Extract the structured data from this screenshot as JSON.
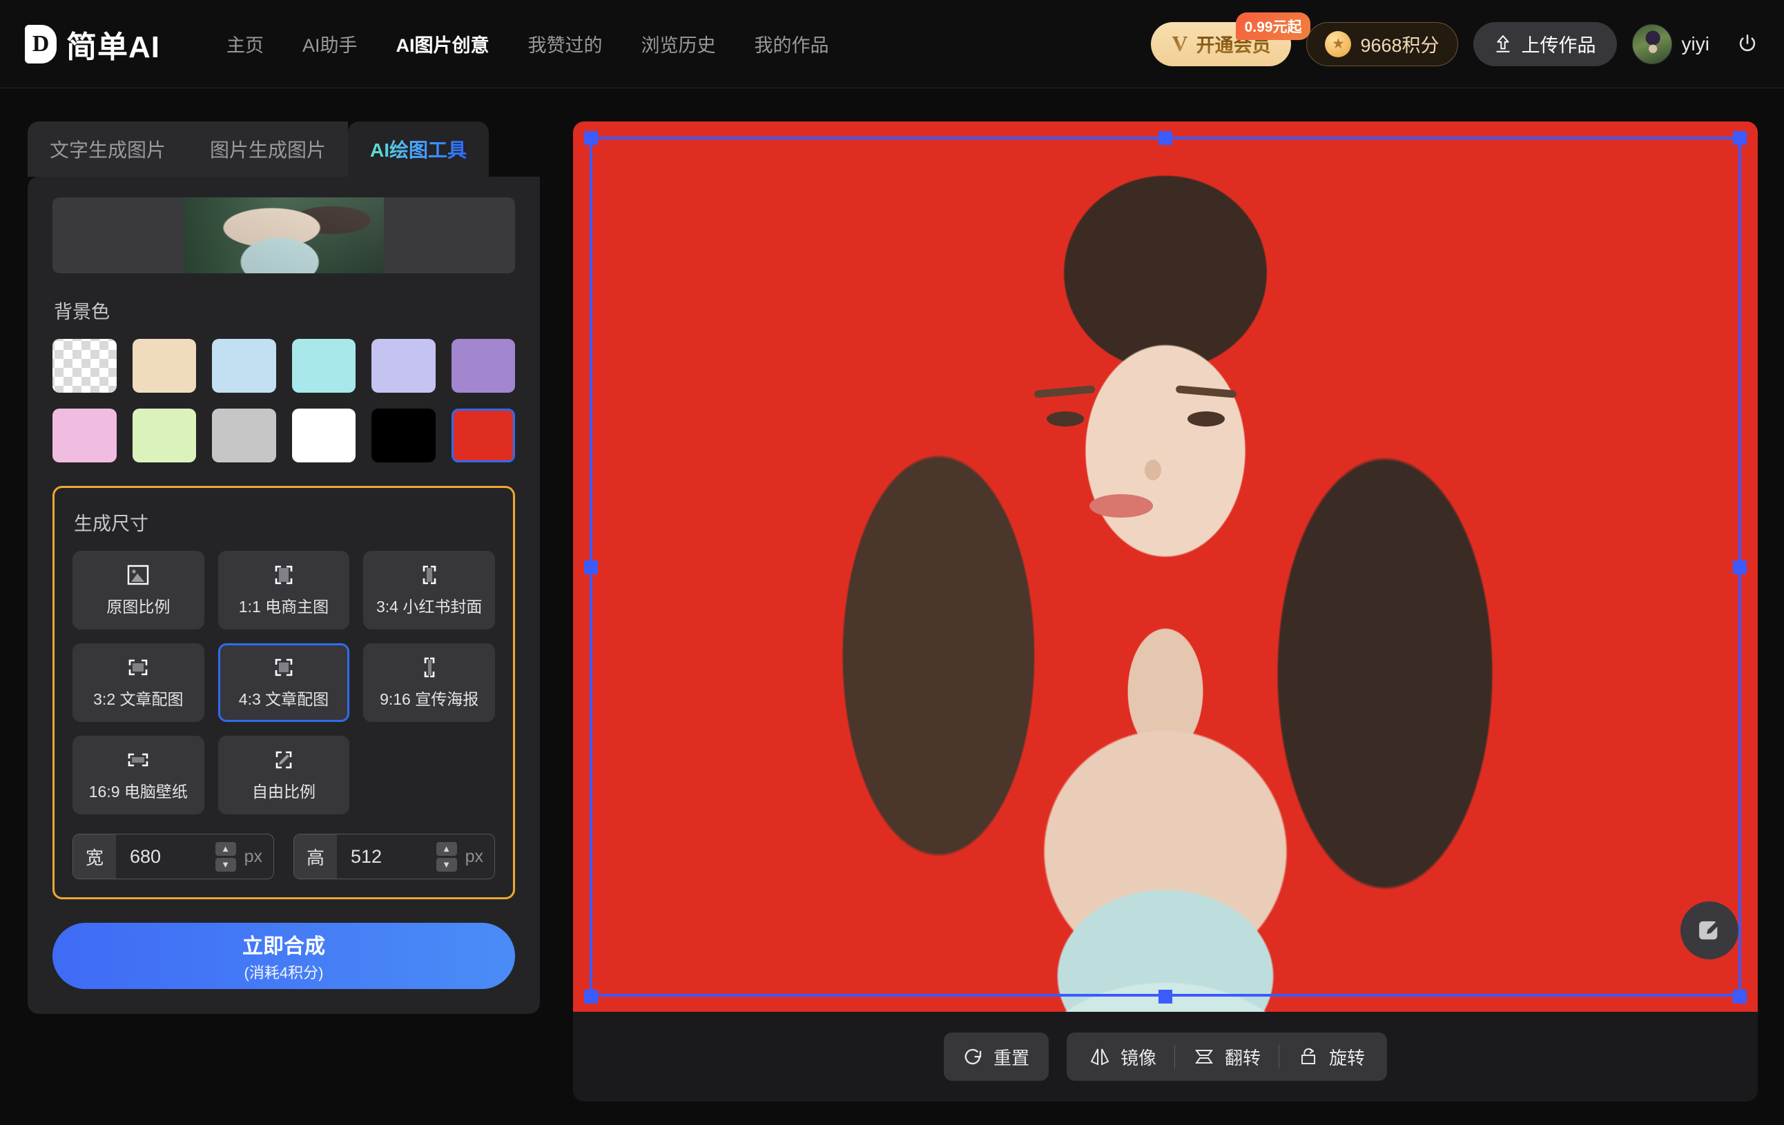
{
  "header": {
    "brand_mark": "D",
    "brand_text": "简单AI",
    "nav": [
      {
        "label": "主页",
        "active": false
      },
      {
        "label": "AI助手",
        "active": false
      },
      {
        "label": "AI图片创意",
        "active": true
      },
      {
        "label": "我赞过的",
        "active": false
      },
      {
        "label": "浏览历史",
        "active": false
      },
      {
        "label": "我的作品",
        "active": false
      }
    ],
    "vip": {
      "label": "开通会员",
      "badge": "0.99元起",
      "icon": "V"
    },
    "points": {
      "label": "9668积分",
      "icon": "star-coin-icon"
    },
    "upload": {
      "label": "上传作品",
      "icon": "upload-icon"
    },
    "user": {
      "name": "yiyi"
    },
    "logout_icon": "power-icon"
  },
  "sidebar": {
    "tabs": [
      {
        "label": "文字生成图片",
        "active": false
      },
      {
        "label": "图片生成图片",
        "active": false
      },
      {
        "label": "AI绘图工具",
        "active": true
      }
    ],
    "background_section": {
      "label": "背景色",
      "swatches": [
        {
          "name": "transparent",
          "color": "transparent",
          "checker": true,
          "selected": false
        },
        {
          "name": "beige",
          "color": "#f0dcbd",
          "checker": false,
          "selected": false
        },
        {
          "name": "light-blue",
          "color": "#c3dff2",
          "checker": false,
          "selected": false
        },
        {
          "name": "cyan",
          "color": "#a8e8ea",
          "checker": false,
          "selected": false
        },
        {
          "name": "periwinkle",
          "color": "#c4c3f2",
          "checker": false,
          "selected": false
        },
        {
          "name": "purple",
          "color": "#a286cf",
          "checker": false,
          "selected": false
        },
        {
          "name": "pink",
          "color": "#f0bde0",
          "checker": false,
          "selected": false
        },
        {
          "name": "light-green",
          "color": "#dcf2bd",
          "checker": false,
          "selected": false
        },
        {
          "name": "gray",
          "color": "#c6c6c6",
          "checker": false,
          "selected": false
        },
        {
          "name": "white",
          "color": "#ffffff",
          "checker": false,
          "selected": false
        },
        {
          "name": "black",
          "color": "#000000",
          "checker": false,
          "selected": false
        },
        {
          "name": "red",
          "color": "#e02d22",
          "checker": false,
          "selected": true
        }
      ]
    },
    "size_section": {
      "label": "生成尺寸",
      "border_color": "#f0a830",
      "options": [
        {
          "label": "原图比例",
          "icon": "original-image-icon",
          "selected": false
        },
        {
          "label": "1:1 电商主图",
          "icon": "crop-square-icon",
          "selected": false
        },
        {
          "label": "3:4 小红书封面",
          "icon": "crop-portrait-icon",
          "selected": false
        },
        {
          "label": "3:2 文章配图",
          "icon": "crop-landscape-icon",
          "selected": false
        },
        {
          "label": "4:3 文章配图",
          "icon": "crop-landscape-icon",
          "selected": true
        },
        {
          "label": "9:16 宣传海报",
          "icon": "crop-tall-icon",
          "selected": false
        },
        {
          "label": "16:9 电脑壁纸",
          "icon": "crop-wide-icon",
          "selected": false
        },
        {
          "label": "自由比例",
          "icon": "crop-free-pencil-icon",
          "selected": false
        }
      ],
      "width": {
        "key": "宽",
        "value": "680",
        "unit": "px"
      },
      "height": {
        "key": "高",
        "value": "512",
        "unit": "px"
      }
    },
    "submit": {
      "label": "立即合成",
      "sub_label": "(消耗4积分)"
    }
  },
  "canvas": {
    "background_color": "#e02d22",
    "selection_color": "#3b5bfc",
    "edit_fab_icon": "edit-pencil-icon",
    "toolbar": {
      "reset": {
        "label": "重置",
        "icon": "refresh-icon"
      },
      "mirror": {
        "label": "镜像",
        "icon": "mirror-horizontal-icon"
      },
      "flip": {
        "label": "翻转",
        "icon": "flip-vertical-icon"
      },
      "rotate": {
        "label": "旋转",
        "icon": "rotate-icon"
      }
    }
  }
}
